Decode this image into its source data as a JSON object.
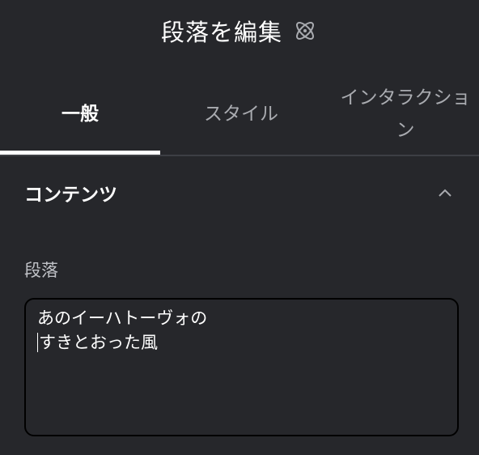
{
  "header": {
    "title": "段落を編集",
    "icon": "atom-icon"
  },
  "tabs": [
    {
      "label": "一般",
      "active": true
    },
    {
      "label": "スタイル",
      "active": false
    },
    {
      "label": "インタラクション",
      "active": false
    }
  ],
  "section": {
    "title": "コンテンツ",
    "expanded": true,
    "toggle_icon": "chevron-up-icon"
  },
  "field": {
    "label": "段落",
    "value_line1": "あのイーハトーヴォの",
    "value_line2": "すきとおった風"
  },
  "colors": {
    "background": "#26272b",
    "text": "#ffffff",
    "muted_text": "#a9abb0",
    "border": "#000000"
  }
}
